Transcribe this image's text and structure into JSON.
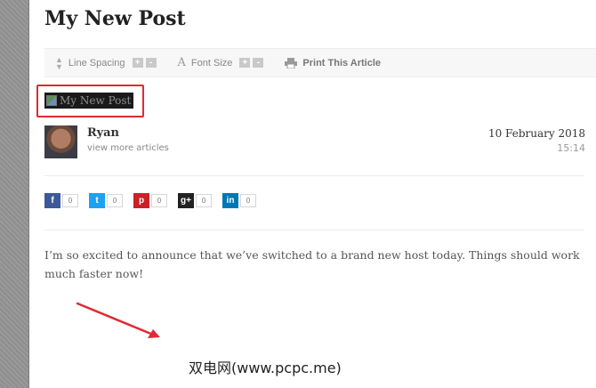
{
  "post": {
    "title": "My New Post"
  },
  "toolbar": {
    "line_spacing_label": "Line Spacing",
    "font_size_label": "Font Size",
    "print_label": "Print This Article",
    "plus": "+",
    "minus": "-"
  },
  "featured_image": {
    "alt_text": "My New Post"
  },
  "author": {
    "name": "Ryan",
    "link_label": "view more articles"
  },
  "meta": {
    "date": "10 February 2018",
    "time": "15:14"
  },
  "share": {
    "items": [
      {
        "network": "facebook",
        "glyph": "f",
        "count": "0",
        "color": "#3b5998"
      },
      {
        "network": "twitter",
        "glyph": "t",
        "count": "0",
        "color": "#1da1f2"
      },
      {
        "network": "pinterest",
        "glyph": "p",
        "count": "0",
        "color": "#cb2027"
      },
      {
        "network": "google-plus",
        "glyph": "g+",
        "count": "0",
        "color": "#222222"
      },
      {
        "network": "linkedin",
        "glyph": "in",
        "count": "0",
        "color": "#0077b5"
      }
    ]
  },
  "content": {
    "paragraph": "I’m so excited to announce that we’ve switched to a brand new host today. Things should work much faster now!"
  },
  "watermark": {
    "text": "双电网(www.pcpc.me)"
  },
  "colors": {
    "highlight": "#e02a32",
    "arrow": "#e02a32"
  }
}
